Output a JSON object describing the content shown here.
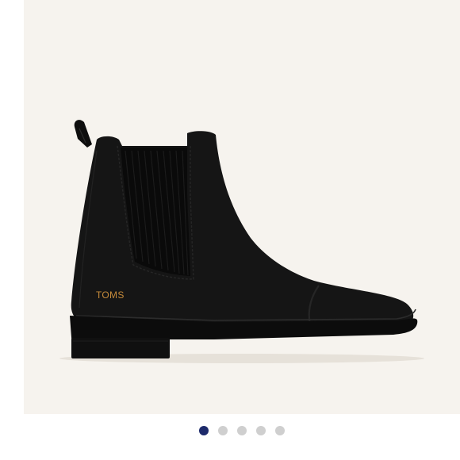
{
  "product": {
    "brand_mark": "TOMS",
    "boot_color": "#141414",
    "panel_color": "#f6f3ee"
  },
  "carousel": {
    "active_index": 0,
    "total": 5,
    "active_color": "#1d2a6b",
    "inactive_color": "#cfcfcf"
  }
}
